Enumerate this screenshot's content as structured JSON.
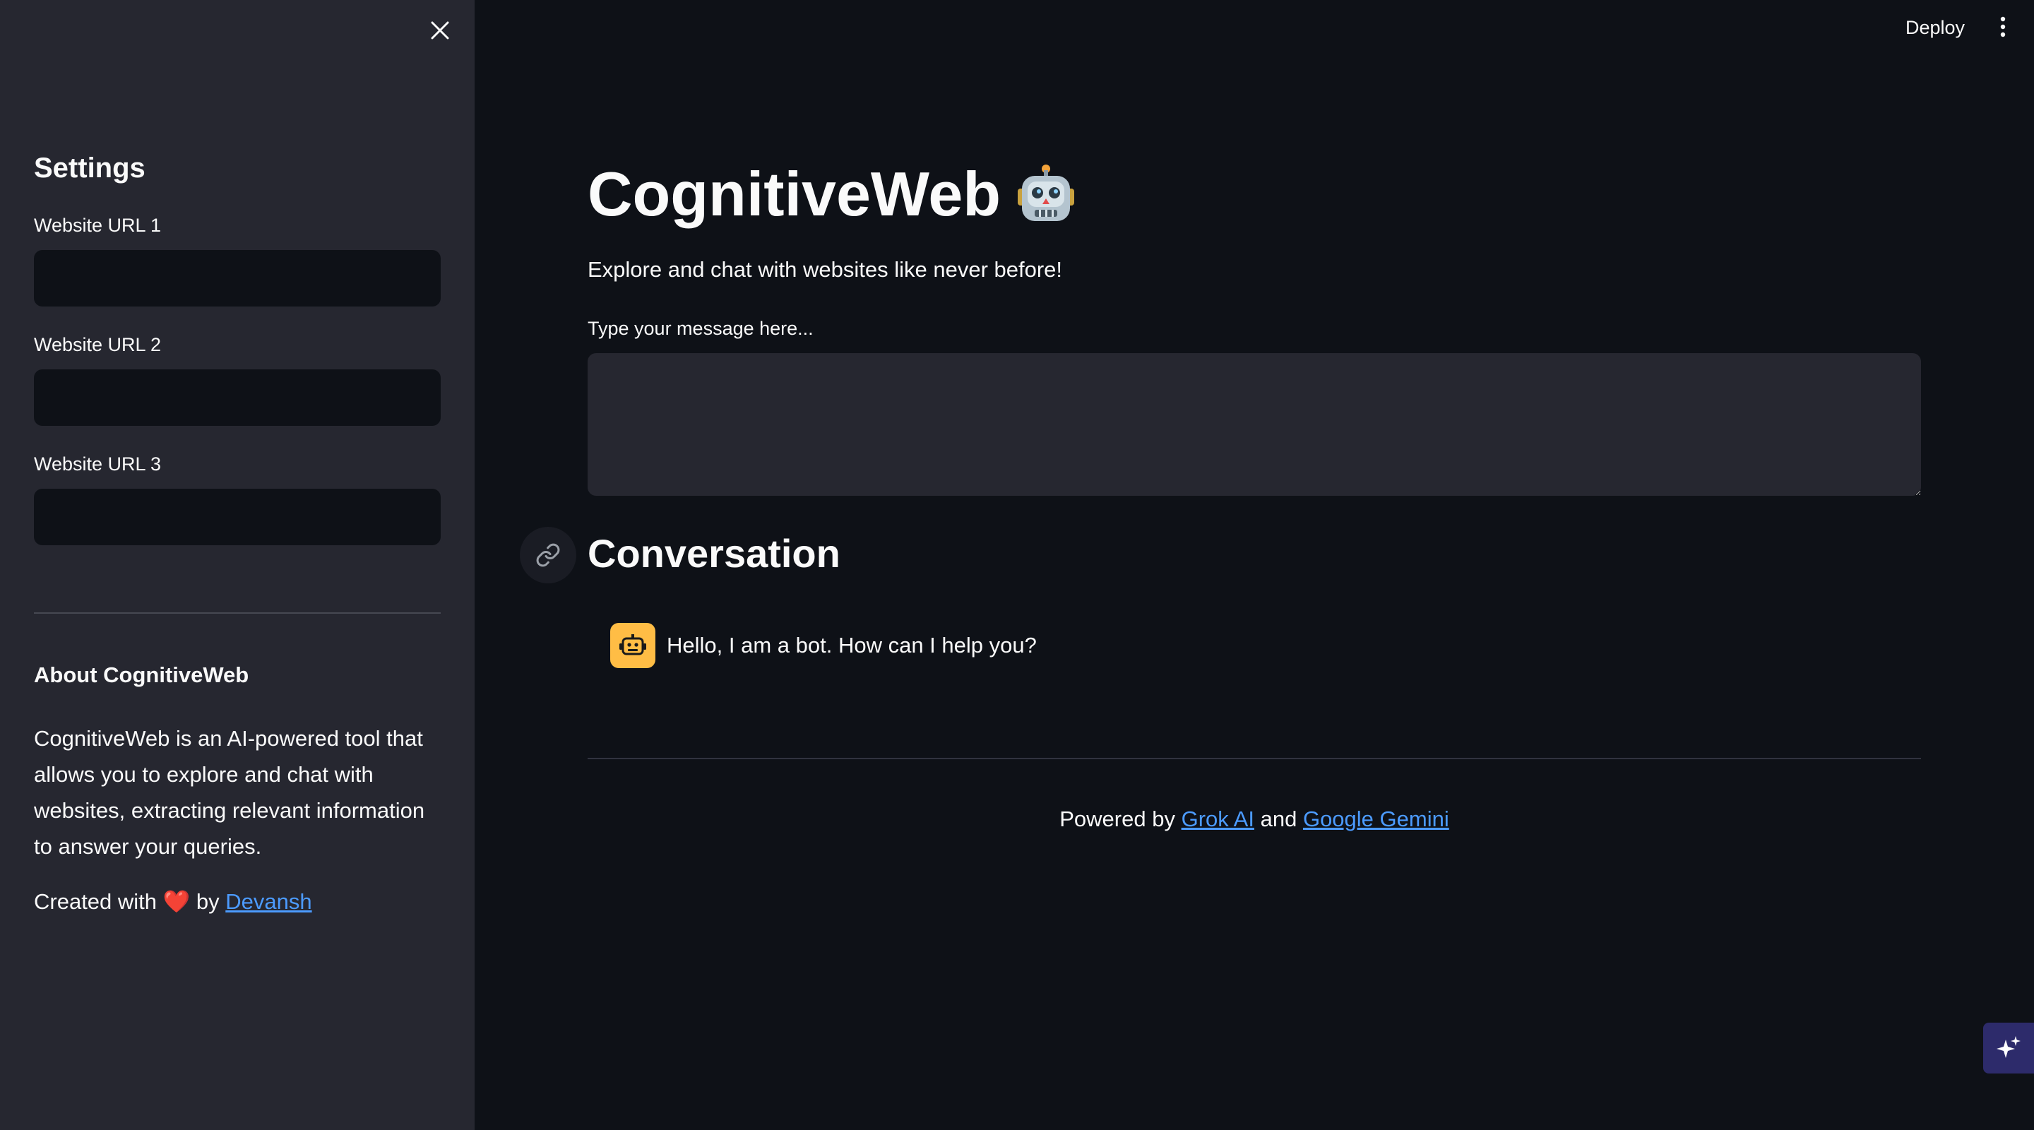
{
  "header": {
    "deploy_label": "Deploy",
    "menu_icon": "vertical-dots-icon"
  },
  "sidebar": {
    "close_icon": "close-icon",
    "title": "Settings",
    "fields": [
      {
        "label": "Website URL 1",
        "value": ""
      },
      {
        "label": "Website URL 2",
        "value": ""
      },
      {
        "label": "Website URL 3",
        "value": ""
      }
    ],
    "about": {
      "title": "About CognitiveWeb",
      "text": "CognitiveWeb is an AI-powered tool that allows you to explore and chat with websites, extracting relevant information to answer your queries.",
      "created_prefix": "Created with",
      "heart": "❤️",
      "created_by": "by",
      "author": "Devansh"
    }
  },
  "main": {
    "title": "CognitiveWeb",
    "title_emoji": "robot-emoji",
    "subtitle": "Explore and chat with websites like never before!",
    "message_label": "Type your message here...",
    "message_value": "",
    "conversation_title": "Conversation",
    "messages": [
      {
        "role": "bot",
        "avatar_icon": "bot-icon",
        "text": "Hello, I am a bot. How can I help you?"
      }
    ],
    "footer": {
      "prefix": "Powered by",
      "link1": "Grok AI",
      "conj": "and",
      "link2": "Google Gemini"
    }
  },
  "colors": {
    "background": "#0e1117",
    "sidebar": "#262730",
    "link": "#4c9bff",
    "bot_avatar": "#ffbd45"
  }
}
